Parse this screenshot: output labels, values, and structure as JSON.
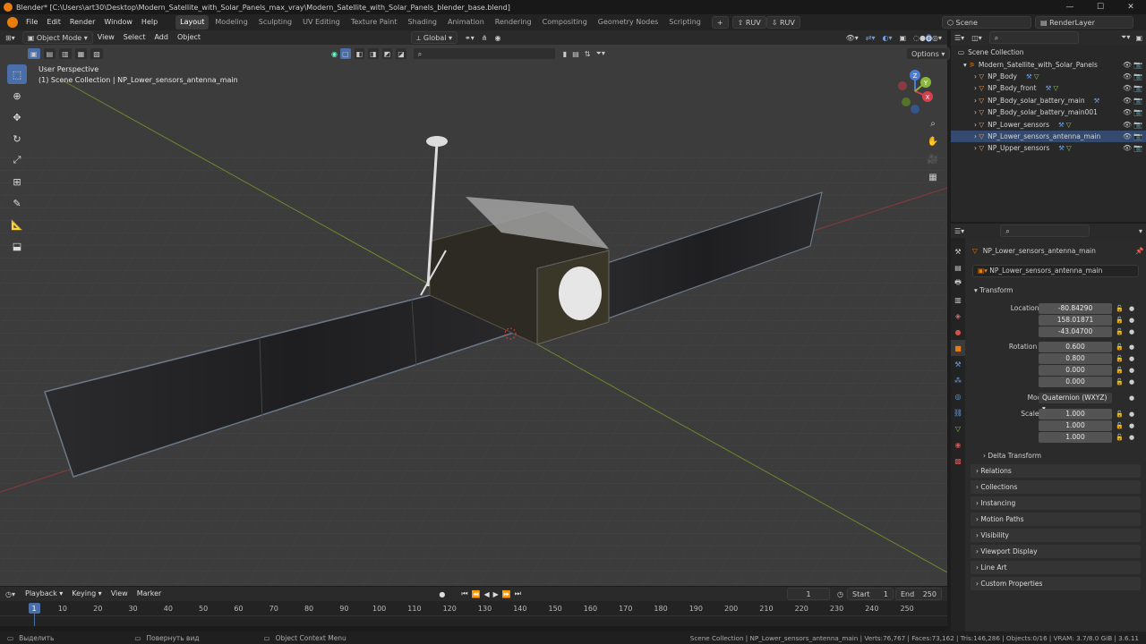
{
  "title_bar": {
    "title": "Blender* [C:\\Users\\art30\\Desktop\\Modern_Satellite_with_Solar_Panels_max_vray\\Modern_Satellite_with_Solar_Panels_blender_base.blend]",
    "minimize": "—",
    "maximize": "☐",
    "close": "✕"
  },
  "menu": {
    "items": [
      "File",
      "Edit",
      "Render",
      "Window",
      "Help"
    ],
    "workspaces": [
      "Layout",
      "Modeling",
      "Sculpting",
      "UV Editing",
      "Texture Paint",
      "Shading",
      "Animation",
      "Rendering",
      "Compositing",
      "Geometry Nodes",
      "Scripting"
    ],
    "active_workspace": "Layout",
    "ruv_1": "RUV",
    "ruv_2": "RUV",
    "scene": "Scene",
    "render_layer": "RenderLayer"
  },
  "viewport_header": {
    "mode": "Object Mode",
    "menus": [
      "View",
      "Select",
      "Add",
      "Object"
    ],
    "orientation": "Global",
    "options": "Options"
  },
  "viewport": {
    "perspective": "User Perspective",
    "collection_info": "(1) Scene Collection | NP_Lower_sensors_antenna_main",
    "gizmo_x": "X",
    "gizmo_y": "Y",
    "gizmo_z": "Z"
  },
  "outliner": {
    "root": "Scene Collection",
    "collection": "Modern_Satellite_with_Solar_Panels",
    "objects": [
      "NP_Body",
      "NP_Body_front",
      "NP_Body_solar_battery_main",
      "NP_Body_solar_battery_main001",
      "NP_Lower_sensors",
      "NP_Lower_sensors_antenna_main",
      "NP_Upper_sensors"
    ],
    "selected": "NP_Lower_sensors_antenna_main"
  },
  "properties": {
    "object_name": "NP_Lower_sensors_antenna_main",
    "object_datablock": "NP_Lower_sensors_antenna_main",
    "transform_label": "Transform",
    "location_label": "Location X",
    "location": {
      "x": "-80.84290",
      "y": "158.01871",
      "z": "-43.04700"
    },
    "rotation_label": "Rotation W",
    "rotation": {
      "w": "0.600",
      "x": "0.800",
      "y": "0.000",
      "z": "0.000"
    },
    "mode_label": "Mode",
    "mode_value": "Quaternion (WXYZ)",
    "scale_label": "Scale X",
    "scale": {
      "x": "1.000",
      "y": "1.000",
      "z": "1.000"
    },
    "axis_y": "Y",
    "axis_z": "Z",
    "axis_x": "X",
    "delta_transform": "Delta Transform",
    "sections": [
      "Relations",
      "Collections",
      "Instancing",
      "Motion Paths",
      "Visibility",
      "Viewport Display",
      "Line Art",
      "Custom Properties"
    ]
  },
  "timeline": {
    "menus": [
      "Playback",
      "Keying",
      "View",
      "Marker"
    ],
    "current_frame": "1",
    "start_label": "Start",
    "start": "1",
    "end_label": "End",
    "end": "250",
    "ticks": [
      "1",
      "10",
      "20",
      "30",
      "40",
      "50",
      "60",
      "70",
      "80",
      "90",
      "100",
      "110",
      "120",
      "130",
      "140",
      "150",
      "160",
      "170",
      "180",
      "190",
      "200",
      "210",
      "220",
      "230",
      "240",
      "250"
    ]
  },
  "status_bar": {
    "select": "Выделить",
    "rotate": "Повернуть вид",
    "context_menu": "Object Context Menu",
    "stats": "Scene Collection | NP_Lower_sensors_antenna_main | Verts:76,767 | Faces:73,162 | Tris:146,286 | Objects:0/16 | VRAM: 3.7/8.0 GiB | 3.6.11"
  },
  "colors": {
    "accent": "#4a6ea8",
    "blender_orange": "#e87d0d",
    "x_axis": "#d6404d",
    "y_axis": "#8ab83a",
    "z_axis": "#4d7ed6"
  }
}
